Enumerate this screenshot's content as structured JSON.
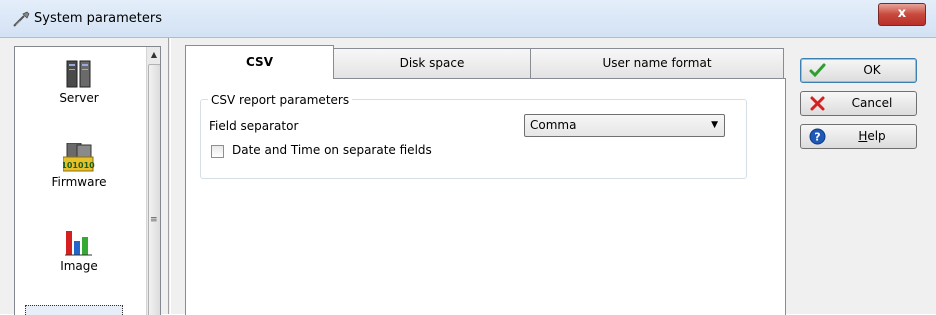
{
  "window": {
    "title": "System parameters",
    "close_label": "x"
  },
  "nav": {
    "items": [
      {
        "label": "Server",
        "icon": "server-icon"
      },
      {
        "label": "Firmware",
        "icon": "firmware-icon"
      },
      {
        "label": "Image",
        "icon": "image-chart-icon"
      }
    ]
  },
  "tabs": [
    {
      "label": "CSV",
      "active": true
    },
    {
      "label": "Disk space",
      "active": false
    },
    {
      "label": "User name format",
      "active": false
    }
  ],
  "csv": {
    "group_title": "CSV report parameters",
    "field_separator_label": "Field separator",
    "field_separator_value": "Comma",
    "date_time_label": "Date and Time on separate fields",
    "date_time_checked": false
  },
  "buttons": {
    "ok": "OK",
    "cancel": "Cancel",
    "help_first": "H",
    "help_rest": "elp"
  },
  "colors": {
    "ok_check": "#2e9e2e",
    "cancel_x": "#d42020",
    "help": "#1f58b5"
  }
}
